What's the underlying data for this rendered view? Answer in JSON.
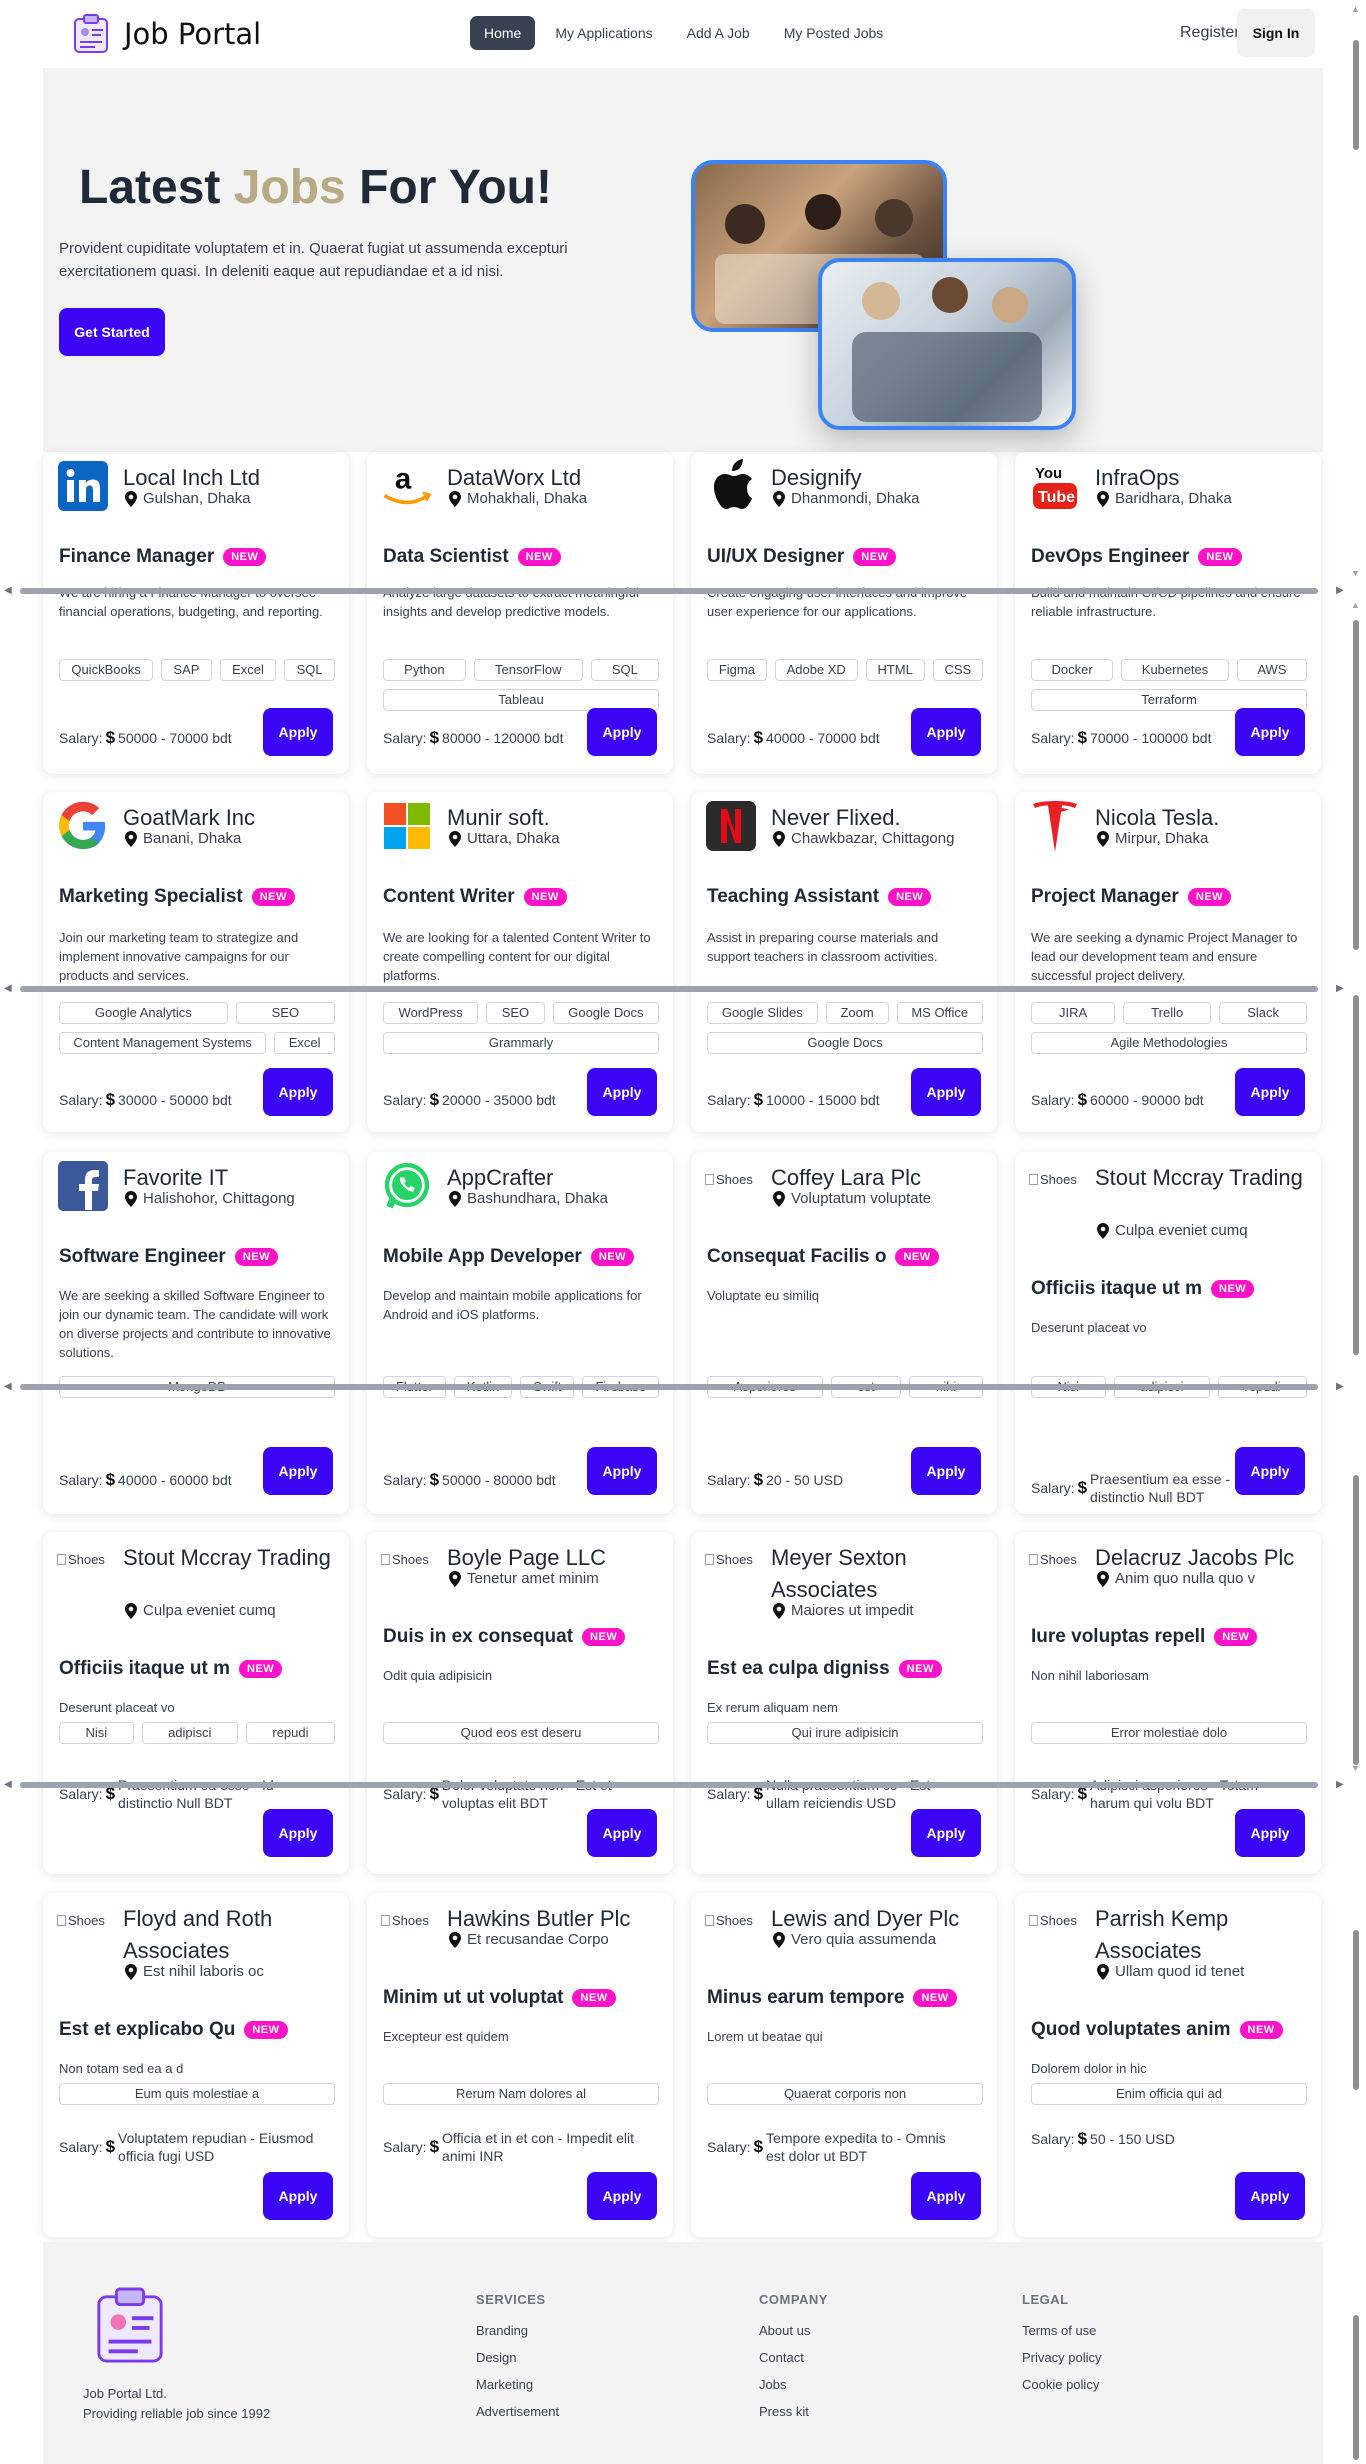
{
  "nav": {
    "brand": "Job Portal",
    "links": [
      "Home",
      "My Applications",
      "Add A Job",
      "My Posted Jobs"
    ],
    "register": "Register",
    "signin": "Sign In"
  },
  "hero": {
    "title_pre": "Latest ",
    "title_accent": "Jobs",
    "title_post": " For You!",
    "text": "Provident cupiditate voluptatem et in. Quaerat fugiat ut assumenda excepturi exercitationem quasi. In deleniti eaque aut repudiandae et a id nisi.",
    "cta": "Get Started"
  },
  "jobs": [
    {
      "company": "Local Inch Ltd",
      "logo": "linkedin-logo",
      "location": "Gulshan, Dhaka",
      "title": "Finance Manager",
      "badge": "NEW",
      "desc": "We are hiring a Finance Manager to oversee financial operations, budgeting, and reporting.",
      "skills": [
        "QuickBooks",
        "SAP",
        "Excel",
        "SQL"
      ],
      "salary_label": "Salary:",
      "salary": "50000 - 70000 bdt",
      "apply": "Apply"
    },
    {
      "company": "DataWorx Ltd",
      "logo": "amazon-logo",
      "location": "Mohakhali, Dhaka",
      "title": "Data Scientist",
      "badge": "NEW",
      "desc": "Analyze large datasets to extract meaningful insights and develop predictive models.",
      "skills": [
        "Python",
        "TensorFlow",
        "SQL",
        "Tableau"
      ],
      "salary_label": "Salary:",
      "salary": "80000 - 120000 bdt",
      "apply": "Apply"
    },
    {
      "company": "Designify",
      "logo": "apple-logo",
      "location": "Dhanmondi, Dhaka",
      "title": "UI/UX Designer",
      "badge": "NEW",
      "desc": "Create engaging user interfaces and improve user experience for our applications.",
      "skills": [
        "Figma",
        "Adobe XD",
        "HTML",
        "CSS"
      ],
      "salary_label": "Salary:",
      "salary": "40000 - 70000 bdt",
      "apply": "Apply"
    },
    {
      "company": "InfraOps",
      "logo": "youtube-logo",
      "location": "Baridhara, Dhaka",
      "title": "DevOps Engineer",
      "badge": "NEW",
      "desc": "Build and maintain CI/CD pipelines and ensure reliable infrastructure.",
      "skills": [
        "Docker",
        "Kubernetes",
        "AWS",
        "Terraform"
      ],
      "salary_label": "Salary:",
      "salary": "70000 - 100000 bdt",
      "apply": "Apply"
    },
    {
      "company": "GoatMark Inc",
      "logo": "google-logo",
      "location": "Banani, Dhaka",
      "title": "Marketing Specialist",
      "badge": "NEW",
      "desc": "Join our marketing team to strategize and implement innovative campaigns for our products and services.",
      "skills": [
        "Google Analytics",
        "SEO",
        "Content Management Systems",
        "Excel"
      ],
      "salary_label": "Salary:",
      "salary": "30000 - 50000 bdt",
      "apply": "Apply"
    },
    {
      "company": "Munir soft.",
      "logo": "microsoft-logo",
      "location": "Uttara, Dhaka",
      "title": "Content Writer",
      "badge": "NEW",
      "desc": "We are looking for a talented Content Writer to create compelling content for our digital platforms.",
      "skills": [
        "WordPress",
        "SEO",
        "Google Docs",
        "Grammarly"
      ],
      "salary_label": "Salary:",
      "salary": "20000 - 35000 bdt",
      "apply": "Apply"
    },
    {
      "company": "Never Flixed.",
      "logo": "netflix-logo",
      "location": "Chawkbazar, Chittagong",
      "title": "Teaching Assistant",
      "badge": "NEW",
      "desc": "Assist in preparing course materials and support teachers in classroom activities.",
      "skills": [
        "Google Slides",
        "Zoom",
        "MS Office",
        "Google Docs"
      ],
      "salary_label": "Salary:",
      "salary": "10000 - 15000 bdt",
      "apply": "Apply"
    },
    {
      "company": "Nicola Tesla.",
      "logo": "tesla-logo",
      "location": "Mirpur, Dhaka",
      "title": "Project Manager",
      "badge": "NEW",
      "desc": "We are seeking a dynamic Project Manager to lead our development team and ensure successful project delivery.",
      "skills": [
        "JIRA",
        "Trello",
        "Slack",
        "Agile Methodologies"
      ],
      "salary_label": "Salary:",
      "salary": "60000 - 90000 bdt",
      "apply": "Apply"
    },
    {
      "company": "Favorite IT",
      "logo": "facebook-logo",
      "location": "Halishohor, Chittagong",
      "title": "Software Engineer",
      "badge": "NEW",
      "desc": "We are seeking a skilled Software Engineer to join our dynamic team. The candidate will work on diverse projects and contribute to innovative solutions.",
      "skills": [
        "MongoDB"
      ],
      "salary_label": "Salary:",
      "salary": "40000 - 60000 bdt",
      "apply": "Apply"
    },
    {
      "company": "AppCrafter",
      "logo": "whatsapp-logo",
      "location": "Bashundhara, Dhaka",
      "title": "Mobile App Developer",
      "badge": "NEW",
      "desc": "Develop and maintain mobile applications for Android and iOS platforms.",
      "skills": [
        "Flutter",
        "Kotlin",
        "Swift",
        "Firebase"
      ],
      "salary_label": "Salary:",
      "salary": "50000 - 80000 bdt",
      "apply": "Apply"
    },
    {
      "company": "Coffey Lara Plc",
      "logo": "Shoes",
      "location": "Voluptatum voluptate",
      "title": "Consequat Facilis o",
      "badge": "NEW",
      "desc": "Voluptate eu similiq",
      "skills": [
        "Asperiores",
        "est",
        "nihi"
      ],
      "salary_label": "Salary:",
      "salary": "20 - 50 USD",
      "apply": "Apply"
    },
    {
      "company": "Stout Mccray Trading",
      "logo": "Shoes",
      "location": "Culpa eveniet cumq",
      "title": "Officiis itaque ut m",
      "badge": "NEW",
      "desc": "Deserunt placeat vo",
      "skills": [
        "Nisi",
        "adipisci",
        "repudi"
      ],
      "salary_label": "Salary:",
      "salary": "Praesentium ea esse - Id distinctio Null BDT",
      "apply": "Apply"
    },
    {
      "company": "Stout Mccray Trading",
      "logo": "Shoes",
      "location": "Culpa eveniet cumq",
      "title": "Officiis itaque ut m",
      "badge": "NEW",
      "desc": "Deserunt placeat vo",
      "skills": [
        "Nisi",
        "adipisci",
        "repudi"
      ],
      "salary_label": "Salary:",
      "salary": "Praesentium ea esse - Id distinctio Null BDT",
      "apply": "Apply"
    },
    {
      "company": "Boyle Page LLC",
      "logo": "Shoes",
      "location": "Tenetur amet minim",
      "title": "Duis in ex consequat",
      "badge": "NEW",
      "desc": "Odit quia adipisicin",
      "skills": [
        "Quod eos est deseru"
      ],
      "salary_label": "Salary:",
      "salary": "Dolor voluptate non - Est et voluptas elit BDT",
      "apply": "Apply"
    },
    {
      "company": "Meyer Sexton Associates",
      "logo": "Shoes",
      "location": "Maiores ut impedit",
      "title": "Est ea culpa digniss",
      "badge": "NEW",
      "desc": "Ex rerum aliquam nem",
      "skills": [
        "Qui irure adipisicin"
      ],
      "salary_label": "Salary:",
      "salary": "Nulla praesentium co - Est ullam reiciendis USD",
      "apply": "Apply"
    },
    {
      "company": "Delacruz Jacobs Plc",
      "logo": "Shoes",
      "location": "Anim quo nulla quo v",
      "title": "Iure voluptas repell",
      "badge": "NEW",
      "desc": "Non nihil laboriosam",
      "skills": [
        "Error molestiae dolo"
      ],
      "salary_label": "Salary:",
      "salary": "Adipisci asperiores - Totam harum qui volu BDT",
      "apply": "Apply"
    },
    {
      "company": "Floyd and Roth Associates",
      "logo": "Shoes",
      "location": "Est nihil laboris oc",
      "title": "Est et explicabo Qu",
      "badge": "NEW",
      "desc": "Non totam sed ea a d",
      "skills": [
        "Eum quis molestiae a"
      ],
      "salary_label": "Salary:",
      "salary": "Voluptatem repudian - Eiusmod officia fugi USD",
      "apply": "Apply"
    },
    {
      "company": "Hawkins Butler Plc",
      "logo": "Shoes",
      "location": "Et recusandae Corpo",
      "title": "Minim ut ut voluptat",
      "badge": "NEW",
      "desc": "Excepteur est quidem",
      "skills": [
        "Rerum Nam dolores al"
      ],
      "salary_label": "Salary:",
      "salary": "Officia et in et con - Impedit elit animi INR",
      "apply": "Apply"
    },
    {
      "company": "Lewis and Dyer Plc",
      "logo": "Shoes",
      "location": "Vero quia assumenda",
      "title": "Minus earum tempore",
      "badge": "NEW",
      "desc": "Lorem ut beatae qui",
      "skills": [
        "Quaerat corporis non"
      ],
      "salary_label": "Salary:",
      "salary": "Tempore expedita to - Omnis est dolor ut BDT",
      "apply": "Apply"
    },
    {
      "company": "Parrish Kemp Associates",
      "logo": "Shoes",
      "location": "Ullam quod id tenet",
      "title": "Quod voluptates anim",
      "badge": "NEW",
      "desc": "Dolorem dolor in hic",
      "skills": [
        "Enim officia qui ad"
      ],
      "salary_label": "Salary:",
      "salary": "50 - 150 USD",
      "apply": "Apply"
    }
  ],
  "footer": {
    "brand_line1": "Job Portal Ltd.",
    "brand_line2": "Providing reliable job since 1992",
    "services_title": "SERVICES",
    "services": [
      "Branding",
      "Design",
      "Marketing",
      "Advertisement"
    ],
    "company_title": "COMPANY",
    "company": [
      "About us",
      "Contact",
      "Jobs",
      "Press kit"
    ],
    "legal_title": "LEGAL",
    "legal": [
      "Terms of use",
      "Privacy policy",
      "Cookie policy"
    ]
  },
  "colors": {
    "primary": "#3b06f5",
    "badge": "#ff12c8",
    "accent": "#b8aa85",
    "nav_active": "#374151"
  }
}
